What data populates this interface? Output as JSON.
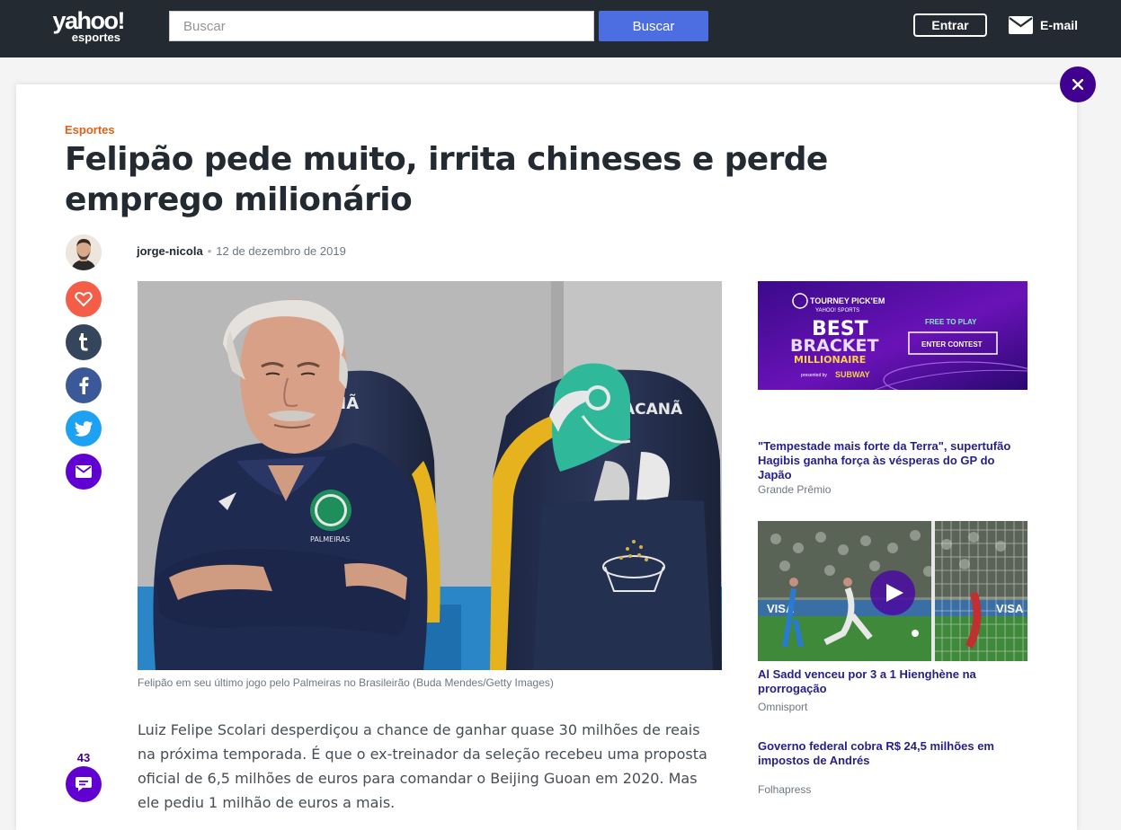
{
  "header": {
    "logo_line1": "yahoo!",
    "logo_line2": "esportes",
    "search_placeholder": "Buscar",
    "search_button": "Buscar",
    "signin_button": "Entrar",
    "mail_label": "E-mail"
  },
  "article": {
    "category": "Esportes",
    "title": "Felipão pede muito, irrita chineses e perde emprego milionário",
    "author": "jorge-nicola",
    "date": "12 de dezembro de 2019",
    "image_caption": "Felipão em seu último jogo pelo Palmeiras no Brasileirão (Buda Mendes/Getty Images)",
    "body": "Luiz Felipe Scolari desperdiçou a chance de ganhar quase 30 milhões de reais na próxima temporada. É que o ex-treinador da seleção recebeu uma proposta oficial de 6,5 milhões de euros para comandar o Beijing Guoan em 2020. Mas ele pediu 1 milhão de euros a mais.",
    "comment_count": "43",
    "image_texts": {
      "seat_left": "CANÃ",
      "seat_right": "ACANÃ",
      "jersey_badge": "PALMEIRAS"
    }
  },
  "share": {
    "icons": [
      "heart-icon",
      "tumblr-icon",
      "facebook-icon",
      "twitter-icon",
      "mail-icon"
    ],
    "colors": [
      "#f45d48",
      "#35465c",
      "#3b5998",
      "#1da1f2",
      "#6001d2"
    ]
  },
  "sidebar": {
    "ad": {
      "line1": "TOURNEY PICK'EM",
      "line2": "YAHOO! SPORTS",
      "line3": "BEST",
      "line4": "BRACKET",
      "line5": "MILLIONAIRE",
      "sponsor_prefix": "presented by",
      "sponsor": "SUBWAY",
      "free_label": "FREE TO PLAY",
      "cta": "ENTER CONTEST"
    },
    "stories": [
      {
        "title": "\"Tempestade mais forte da Terra\", supertufão Hagibis ganha força às vésperas do GP do Japão",
        "source": "Grande Prêmio"
      },
      {
        "title": "Al Sadd venceu por 3 a 1 Hienghène na prorrogação",
        "source": "Omnisport"
      },
      {
        "title": "Governo federal cobra R$ 24,5 milhões em impostos de Andrés",
        "source": "Folhapress"
      }
    ],
    "video_board_text": "VISA"
  },
  "colors": {
    "accent": "#400090",
    "link": "#26218a",
    "category": "#e0611a",
    "header_bg": "#232a31"
  }
}
